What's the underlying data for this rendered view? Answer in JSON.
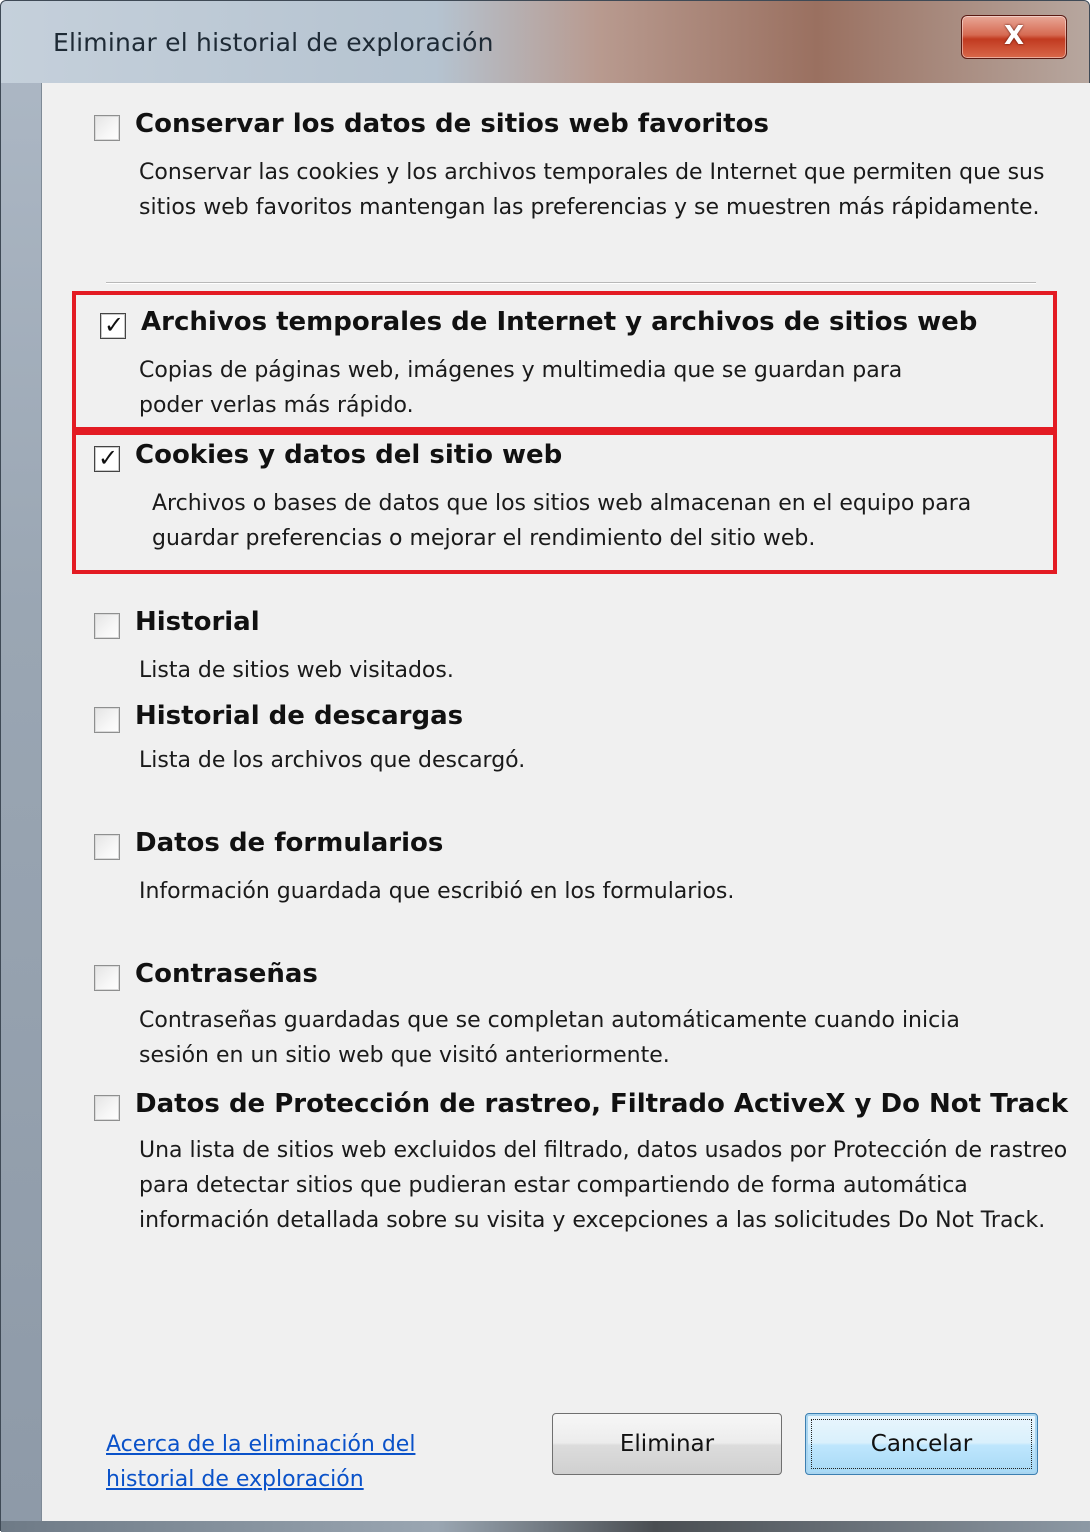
{
  "window": {
    "title": "Eliminar el historial de exploración",
    "close_label": "X"
  },
  "options": [
    {
      "title": "Conservar los datos de sitios web favoritos",
      "description": "Conservar las cookies y los archivos temporales de Internet que permiten que sus sitios web favoritos mantengan las preferencias y se muestren más rápidamente.",
      "checked": false
    },
    {
      "title": "Archivos temporales de Internet y archivos de sitios web",
      "description": "Copias de páginas web, imágenes y multimedia que se guardan para poder verlas más rápido.",
      "checked": true
    },
    {
      "title": "Cookies y datos del sitio web",
      "description": "Archivos o bases de datos que los sitios web almacenan en el equipo para guardar preferencias o mejorar el rendimiento del sitio web.",
      "checked": true
    },
    {
      "title": "Historial",
      "description": "Lista de sitios web visitados.",
      "checked": false
    },
    {
      "title": "Historial de descargas",
      "description": "Lista de los archivos que descargó.",
      "checked": false
    },
    {
      "title": "Datos de formularios",
      "description": "Información guardada que escribió en los formularios.",
      "checked": false
    },
    {
      "title": "Contraseñas",
      "description": "Contraseñas guardadas que se completan automáticamente cuando inicia sesión en un sitio web que visitó anteriormente.",
      "checked": false
    },
    {
      "title": "Datos de Protección de rastreo, Filtrado ActiveX y Do Not Track",
      "description": "Una lista de sitios web excluidos del filtrado, datos usados por Protección de rastreo para detectar sitios que pudieran estar compartiendo de forma automática información detallada sobre su visita y excepciones a las solicitudes Do Not Track.",
      "checked": false
    }
  ],
  "footer": {
    "about_link": "Acerca de la eliminación del historial de exploración",
    "delete_label": "Eliminar",
    "cancel_label": "Cancelar"
  },
  "colors": {
    "highlight": "#e31b23",
    "link": "#0a52c9"
  }
}
